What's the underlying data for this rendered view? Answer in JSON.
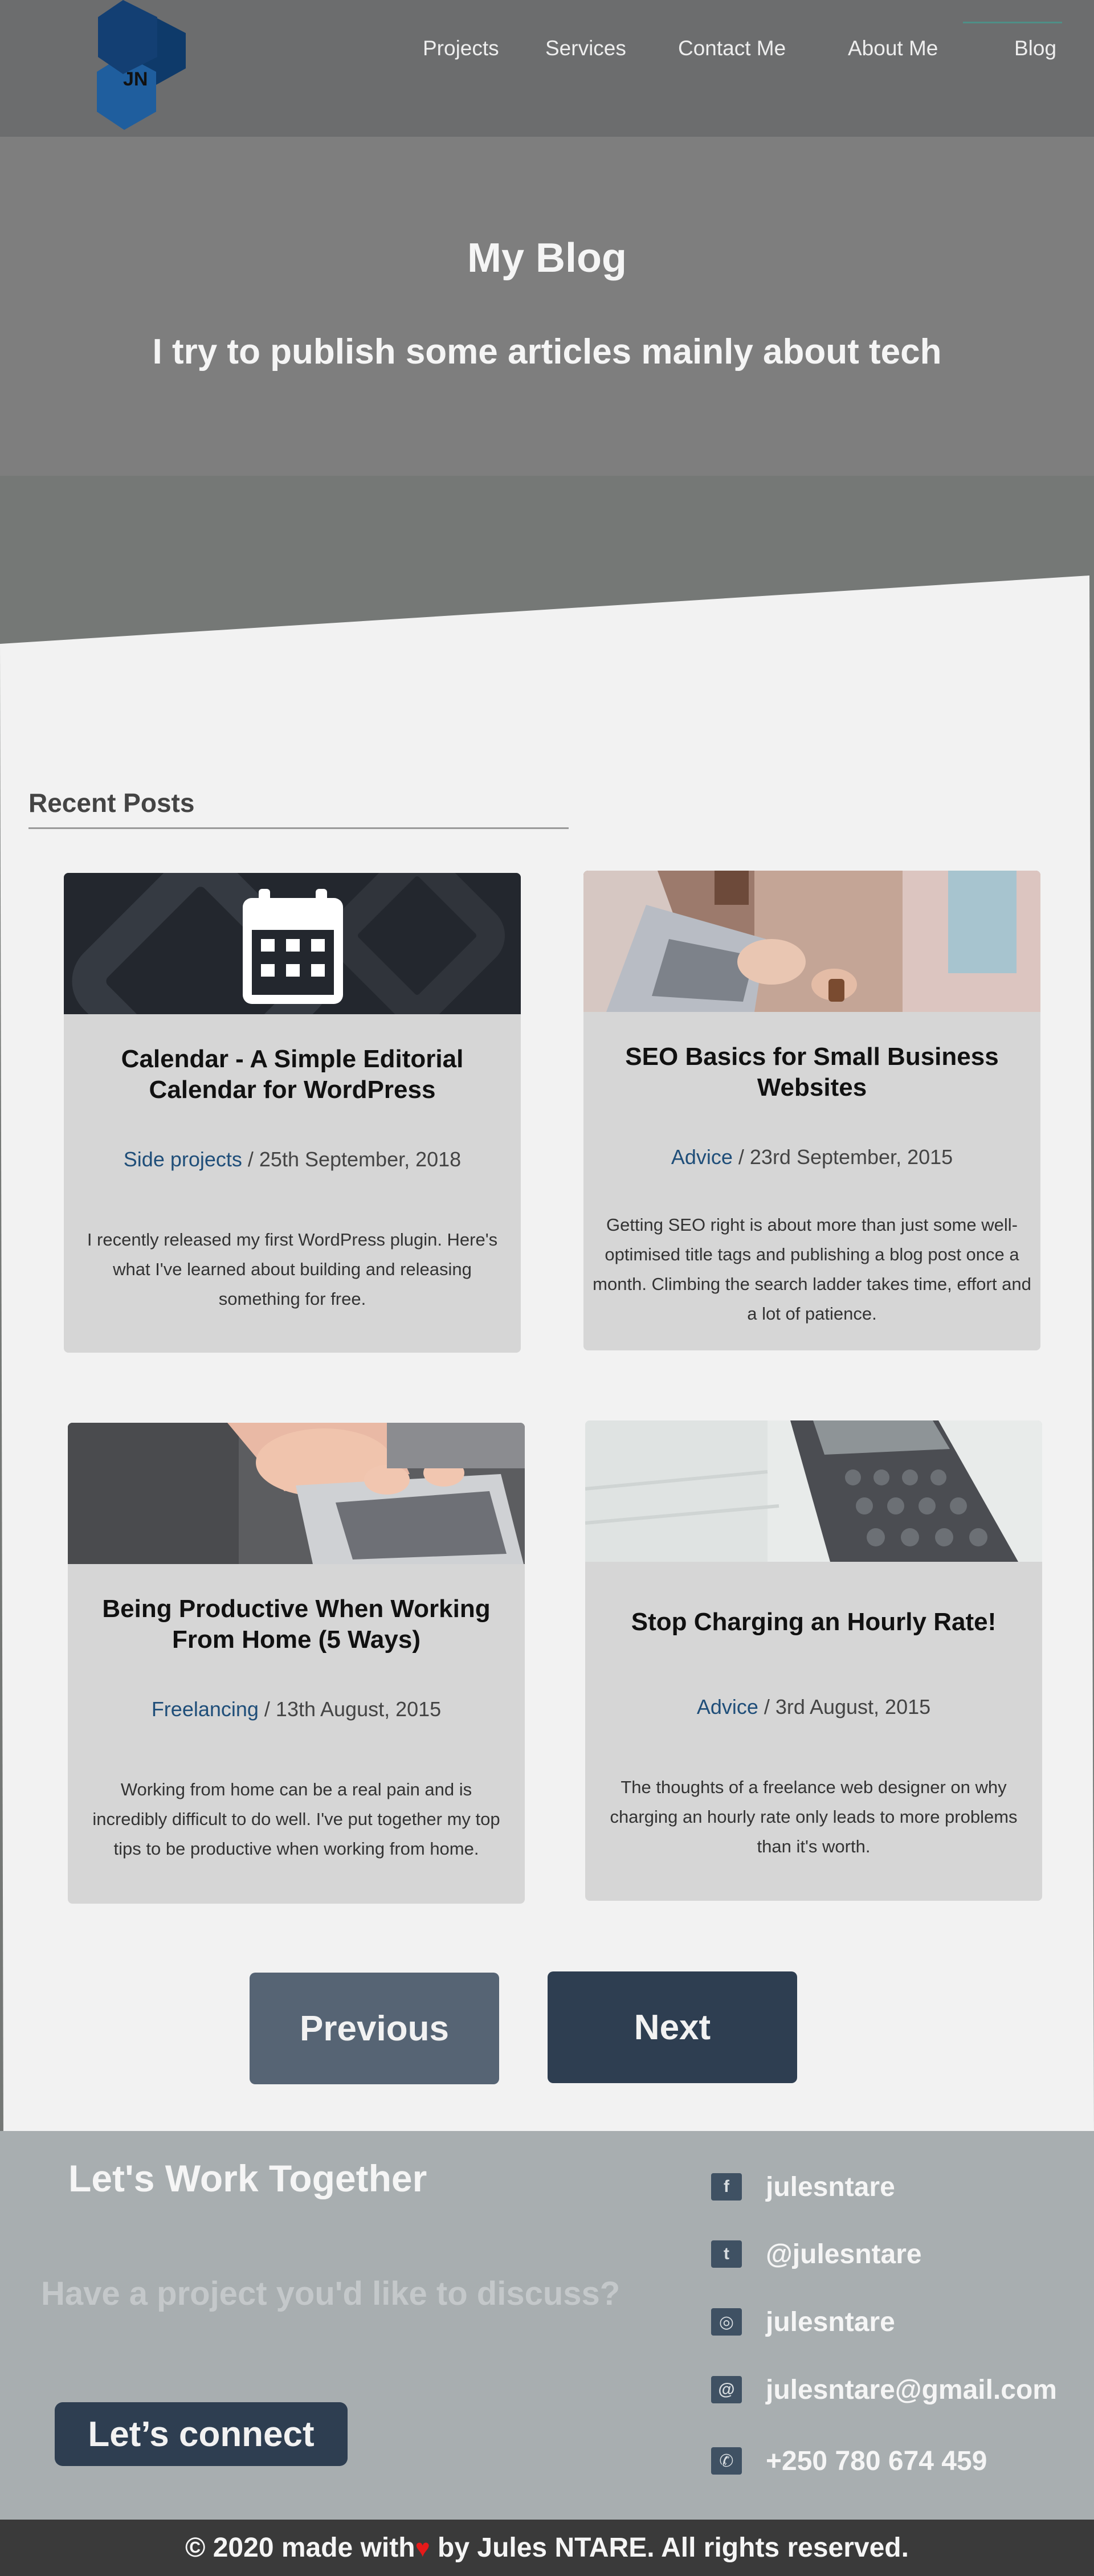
{
  "header": {
    "logo_text": "JN",
    "nav": [
      {
        "label": "Projects"
      },
      {
        "label": "Services"
      },
      {
        "label": "Contact Me"
      },
      {
        "label": "About Me"
      },
      {
        "label": "Blog"
      }
    ]
  },
  "hero": {
    "title": "My Blog",
    "subtitle": "I try to publish some articles mainly about tech"
  },
  "posts_section": {
    "title": "Recent Posts"
  },
  "posts": [
    {
      "title": "Calendar - A Simple Editorial Calendar for WordPress",
      "category": "Side projects",
      "date": " / 25th September, 2018",
      "excerpt": "I recently released my first WordPress plugin. Here's what I've learned about building and releasing something for free."
    },
    {
      "title": "SEO Basics for Small Business Websites",
      "category": "Advice",
      "date": " / 23rd September, 2015",
      "excerpt": "Getting SEO right is about more than just some well-optimised title tags and publishing a blog post once a month. Climbing the search ladder takes time, effort and a lot of patience."
    },
    {
      "title": "Being Productive When Working From Home (5 Ways)",
      "category": "Freelancing",
      "date": " / 13th August, 2015",
      "excerpt": "Working from home can be a real pain and is incredibly difficult to do well. I've put together my top tips to be productive when working from home."
    },
    {
      "title": "Stop Charging an Hourly Rate!",
      "category": "Advice",
      "date": " / 3rd August, 2015",
      "excerpt": "The thoughts of a freelance web designer on why charging an hourly rate only leads to more problems than it's worth."
    }
  ],
  "pagination": {
    "previous_label": "Previous",
    "next_label": "Next"
  },
  "footer": {
    "cta_title": "Let's Work Together",
    "cta_question": "Have a project you'd like to discuss?",
    "cta_button": "Let’s connect",
    "contacts": [
      {
        "icon": "facebook-icon",
        "glyph": "f",
        "text": "julesntare"
      },
      {
        "icon": "twitter-icon",
        "glyph": "t",
        "text": "@julesntare"
      },
      {
        "icon": "instagram-icon",
        "glyph": "◎",
        "text": "julesntare"
      },
      {
        "icon": "email-icon",
        "glyph": "@",
        "text": "julesntare@gmail.com"
      },
      {
        "icon": "whatsapp-icon",
        "glyph": "✆",
        "text": "+250 780 674 459"
      }
    ],
    "copyright_before": "© 2020 made with",
    "copyright_heart": "♥",
    "copyright_after": " by Jules NTARE. All rights reserved."
  },
  "colors": {
    "accent": "#2e3e51",
    "link": "#1f4e79",
    "sheet": "#f2f2f2",
    "footer": "#a8aeb0"
  }
}
